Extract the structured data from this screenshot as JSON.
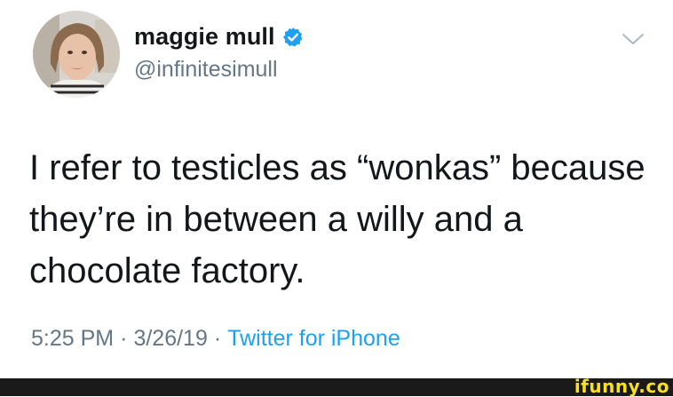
{
  "user": {
    "display_name": "maggie mull",
    "handle": "@infinitesimull",
    "verified": true,
    "avatar_icon": "avatar"
  },
  "tweet": {
    "text": "I refer to testicles as “wonkas” because\nthey’re in between a willy and a\nchocolate factory.",
    "time": "5:25 PM",
    "date": "3/26/19",
    "separator": "·",
    "source": "Twitter for iPhone"
  },
  "footer": {
    "watermark": "ifunny.co"
  },
  "colors": {
    "text": "#14171a",
    "secondary": "#657786",
    "accent": "#1da1f2",
    "watermark": "#f9e01a",
    "footer_bg": "#1a1a1a"
  }
}
